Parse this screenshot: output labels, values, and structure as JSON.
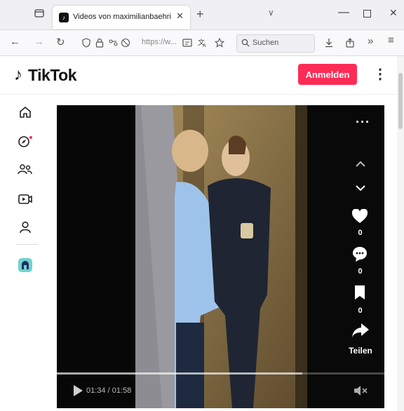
{
  "browser": {
    "tab_title": "Videos von maximilianbaehring",
    "tab_close": "✕",
    "newtab": "+",
    "tab_list": "∨",
    "win_min": "—",
    "win_close": "✕",
    "url_text": "https://w...",
    "search_placeholder": "Suchen"
  },
  "tiktok": {
    "logo_text": "TikTok",
    "login_label": "Anmelden",
    "more": "⋮"
  },
  "video": {
    "likes": "0",
    "comments": "0",
    "saves": "0",
    "share_label": "Teilen",
    "time": "01:34 / 01:58",
    "progress": 0.75
  },
  "colors": {
    "accent": "#fe2c55",
    "notification_dot": "#fe2c55"
  },
  "icons": [
    "tabs-icon",
    "back-icon",
    "forward-icon",
    "reload-icon",
    "shield-icon",
    "lock-icon",
    "permissions-icon",
    "reader-icon",
    "translate-icon",
    "bookmark-star-icon",
    "search-icon",
    "download-icon",
    "share-icon",
    "overflow-icon",
    "menu-icon",
    "home-icon",
    "explore-icon",
    "following-icon",
    "live-icon",
    "profile-icon",
    "creator-avatar-icon",
    "heart-icon",
    "comment-icon",
    "bookmark-icon",
    "share-arrow-icon",
    "play-icon",
    "mute-icon"
  ]
}
